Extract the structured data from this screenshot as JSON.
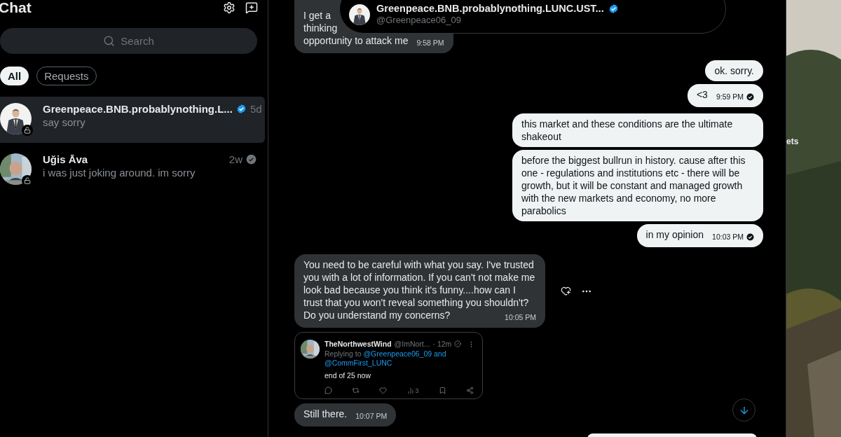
{
  "sidebar": {
    "title": "Chat",
    "search": {
      "placeholder": "Search"
    },
    "filters": [
      {
        "label": "All",
        "selected": true
      },
      {
        "label": "Requests",
        "selected": false
      }
    ],
    "conversations": [
      {
        "name": "Greenpeace.BNB.probablynothing.L...",
        "verified": true,
        "time": "5d",
        "preview": "say sorry",
        "selected": true
      },
      {
        "name": "Uğis Āva",
        "verified": false,
        "time": "2w",
        "preview": "i was just joking around. im sorry",
        "selected": false
      }
    ]
  },
  "chat_header": {
    "name": "Greenpeace.BNB.probablynothing.LUNC.UST...",
    "verified": true,
    "handle": "@Greenpeace06_09"
  },
  "messages": [
    {
      "kind": "text",
      "sent": false,
      "lines": [
        "I get a",
        "thinking",
        "opportunity to attack me"
      ],
      "time": "9:58 PM"
    },
    {
      "kind": "text",
      "sent": true,
      "lines": [
        "ok. sorry."
      ]
    },
    {
      "kind": "text",
      "sent": true,
      "lines": [
        "<3"
      ],
      "time": "9:59 PM",
      "read": true
    },
    {
      "kind": "text",
      "sent": true,
      "lines": [
        "this market and these conditions are the ultimate shakeout"
      ]
    },
    {
      "kind": "text",
      "sent": true,
      "lines": [
        "before the biggest bullrun in history. cause after this one - regulations and institutions etc - there will be growth, but it will be constant and managed growth with the new markets and economy, no more parabolics"
      ]
    },
    {
      "kind": "text",
      "sent": true,
      "lines": [
        "in my opinion"
      ],
      "time": "10:03 PM",
      "read": true
    },
    {
      "kind": "text",
      "sent": false,
      "lines": [
        "You need to be careful with what you say.  I've trusted you with a lot of information.  If you can't not make me look bad because you think it's funny....how can I trust that you won't reveal something you shouldn't?  Do you understand my concerns?"
      ],
      "time": "10:05 PM",
      "actions": true
    },
    {
      "kind": "tweet",
      "sent": false,
      "author": "TheNorthwestWind",
      "handle": "@ImNort...",
      "age": "· 12m",
      "replying": {
        "prefix": "Replying to",
        "mentions": [
          "@Greenpeace06_09",
          "@CommFirst_LUNC"
        ],
        "joiner": "and"
      },
      "text": "end of 25 now",
      "views": "3"
    },
    {
      "kind": "text",
      "sent": false,
      "lines": [
        "Still there."
      ],
      "time": "10:07 PM"
    }
  ],
  "side_panel": {
    "label": "ets"
  }
}
